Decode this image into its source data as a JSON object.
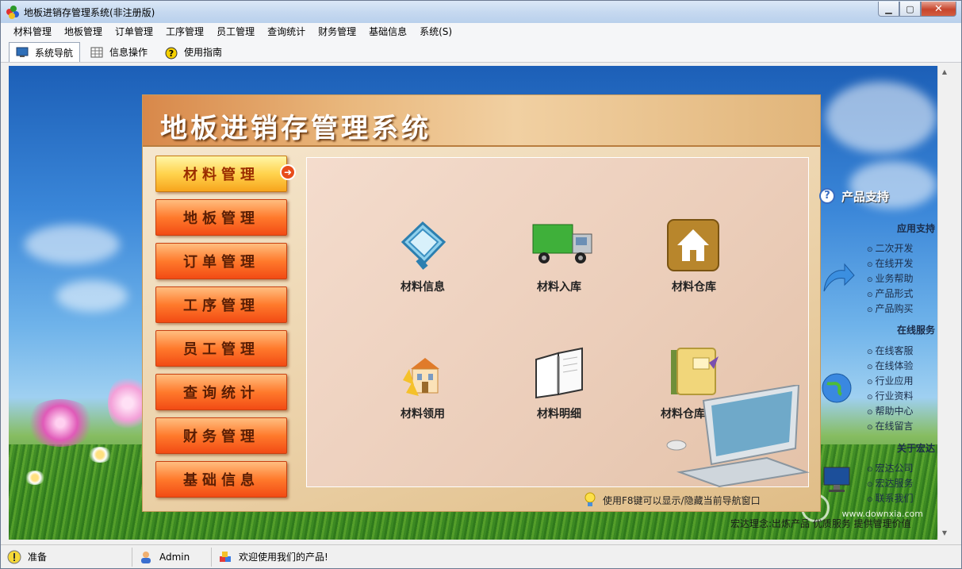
{
  "window": {
    "title": "地板进销存管理系统(非注册版)"
  },
  "menubar": {
    "items": [
      "材料管理",
      "地板管理",
      "订单管理",
      "工序管理",
      "员工管理",
      "查询统计",
      "财务管理",
      "基础信息",
      "系统(S)"
    ]
  },
  "toolbar": {
    "tabs": [
      {
        "label": "系统导航",
        "icon": "monitor-icon",
        "active": true
      },
      {
        "label": "信息操作",
        "icon": "grid-icon",
        "active": false
      },
      {
        "label": "使用指南",
        "icon": "help-icon",
        "active": false
      }
    ]
  },
  "panel": {
    "title": "地板进销存管理系统",
    "nav": [
      "材料管理",
      "地板管理",
      "订单管理",
      "工序管理",
      "员工管理",
      "查询统计",
      "财务管理",
      "基础信息"
    ],
    "active_nav": "材料管理",
    "tiles": [
      {
        "label": "材料信息",
        "icon": "document-icon"
      },
      {
        "label": "材料入库",
        "icon": "truck-icon"
      },
      {
        "label": "材料仓库",
        "icon": "house-icon"
      },
      {
        "label": "材料领用",
        "icon": "building-icon"
      },
      {
        "label": "材料明细",
        "icon": "notebook-icon"
      },
      {
        "label": "材料仓库明细",
        "icon": "folder-icon"
      }
    ],
    "hint": "使用F8键可以显示/隐藏当前导航窗口"
  },
  "support": {
    "title": "产品支持",
    "sections": [
      {
        "heading": "应用支持",
        "links": [
          "二次开发",
          "在线开发",
          "业务帮助",
          "产品形式",
          "产品购买"
        ]
      },
      {
        "heading": "在线服务",
        "links": [
          "在线客服",
          "在线体验",
          "行业应用",
          "行业资料",
          "帮助中心",
          "在线留言"
        ]
      },
      {
        "heading": "关于宏达",
        "links": [
          "宏达公司",
          "宏达服务",
          "联系我们"
        ]
      }
    ]
  },
  "footer_text": "宏达理念:出炼产品 优质服务 提供管理价值",
  "watermark": "www.downxia.com",
  "statusbar": {
    "status": "准备",
    "user": "Admin",
    "message": "欢迎使用我们的产品!"
  },
  "colors": {
    "accent_orange": "#ff7a2c",
    "active_yellow": "#ffd34d",
    "panel_bg": "#ecd3ab"
  }
}
